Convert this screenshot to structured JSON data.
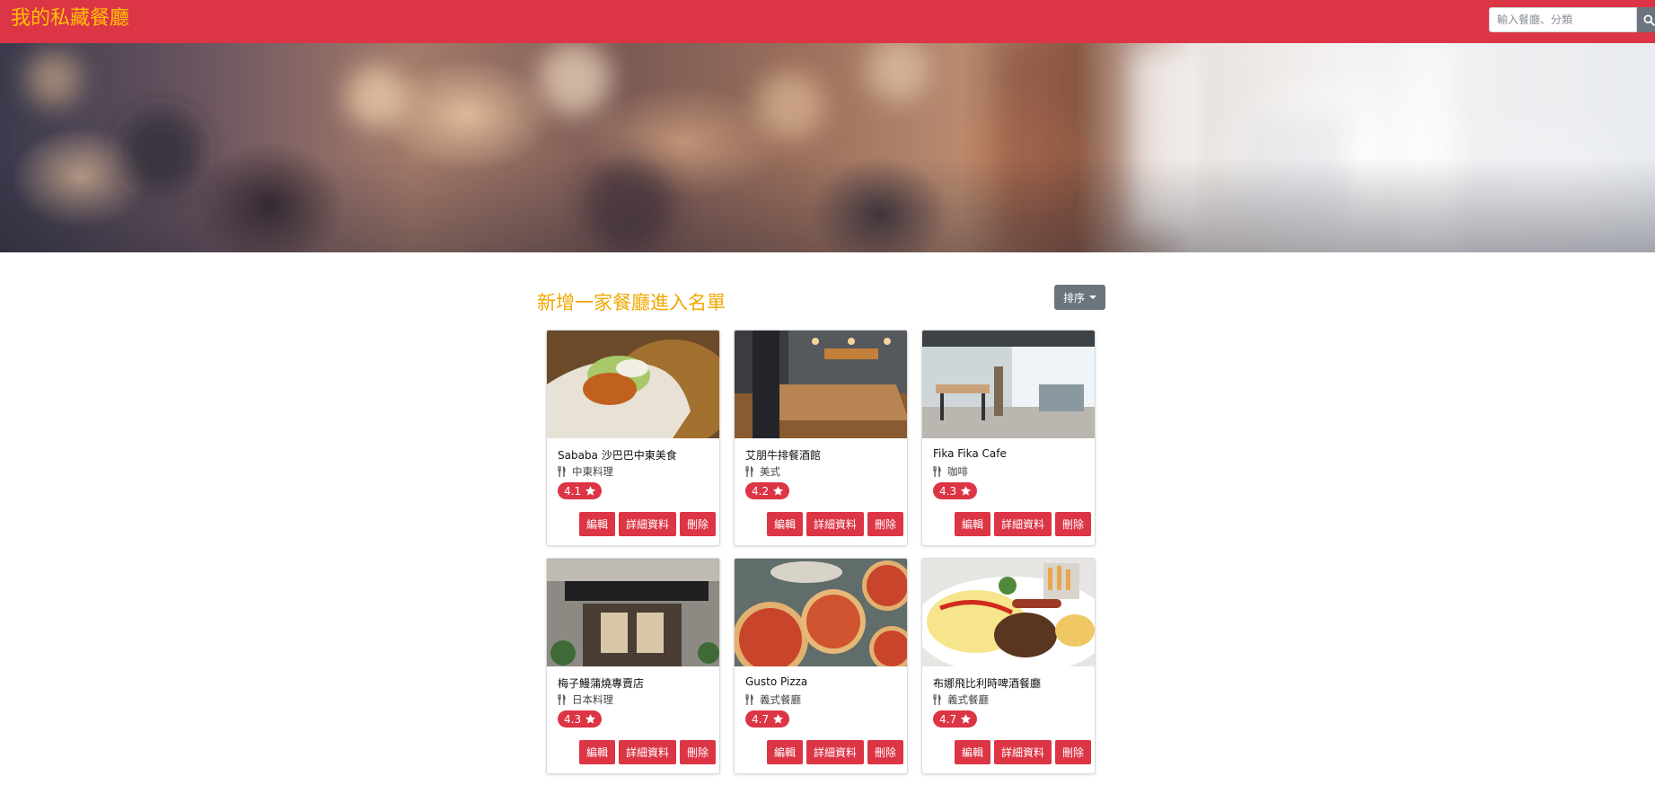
{
  "navbar": {
    "brand": "我的私藏餐廳",
    "search": {
      "placeholder": "輸入餐廳、分類",
      "value": ""
    }
  },
  "main": {
    "add_link": "新增一家餐廳進入名單",
    "sort_label": "排序"
  },
  "colors": {
    "primary": "#dc3545",
    "brand_text": "#ffc107",
    "secondary": "#6c757d"
  },
  "restaurants": [
    {
      "name": "Sababa 沙巴巴中東美食",
      "category": "中東料理",
      "rating": "4.1",
      "image": "wrap-food-photo"
    },
    {
      "name": "艾朋牛排餐酒館",
      "category": "美式",
      "rating": "4.2",
      "image": "restaurant-interior-photo"
    },
    {
      "name": "Fika Fika Cafe",
      "category": "咖啡",
      "rating": "4.3",
      "image": "cafe-interior-photo"
    },
    {
      "name": "梅子鰻蒲燒專賣店",
      "category": "日本料理",
      "rating": "4.3",
      "image": "storefront-photo"
    },
    {
      "name": "Gusto Pizza",
      "category": "義式餐廳",
      "rating": "4.7",
      "image": "pizza-photo"
    },
    {
      "name": "布娜飛比利時啤酒餐廳",
      "category": "義式餐廳",
      "rating": "4.7",
      "image": "omelette-plate-photo"
    }
  ],
  "card_actions": {
    "edit": "編輯",
    "detail": "詳細資料",
    "delete": "刪除"
  }
}
